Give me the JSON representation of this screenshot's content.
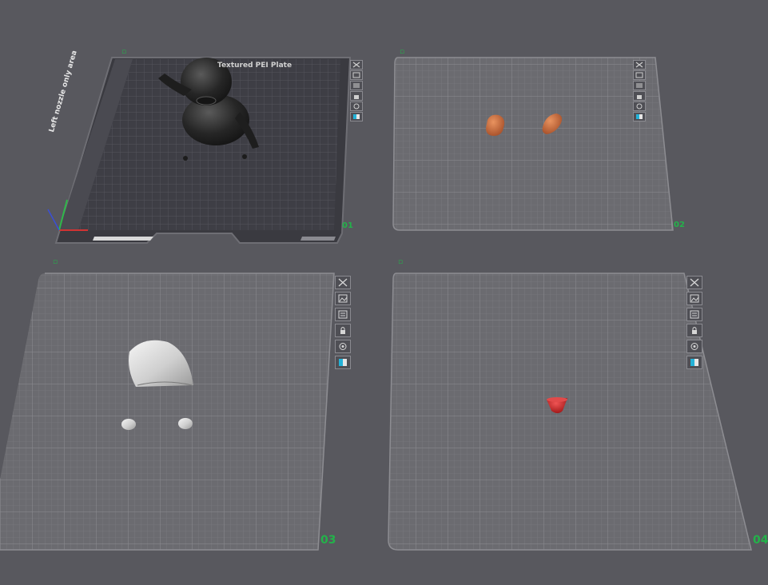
{
  "plates": [
    {
      "number": "01",
      "type": "textured",
      "bed_title": "Textured PEI Plate",
      "bed_side_label": "Left nozzle only area"
    },
    {
      "number": "02",
      "type": "grid"
    },
    {
      "number": "03",
      "type": "grid"
    },
    {
      "number": "04",
      "type": "grid"
    }
  ],
  "toolbar_icons": [
    "close-icon",
    "preview-icon",
    "arrange-icon",
    "lock-icon",
    "settings-icon",
    "color-icon"
  ],
  "colors": {
    "background": "#58585e",
    "plate_grid": "#6b6b70",
    "plate_line": "#7d7d82",
    "plate_number": "#23b24a",
    "model_orange": "#c86a3c",
    "model_red": "#d12b2b",
    "model_dark": "#2b2b2b",
    "model_white": "#e8e8e8"
  }
}
